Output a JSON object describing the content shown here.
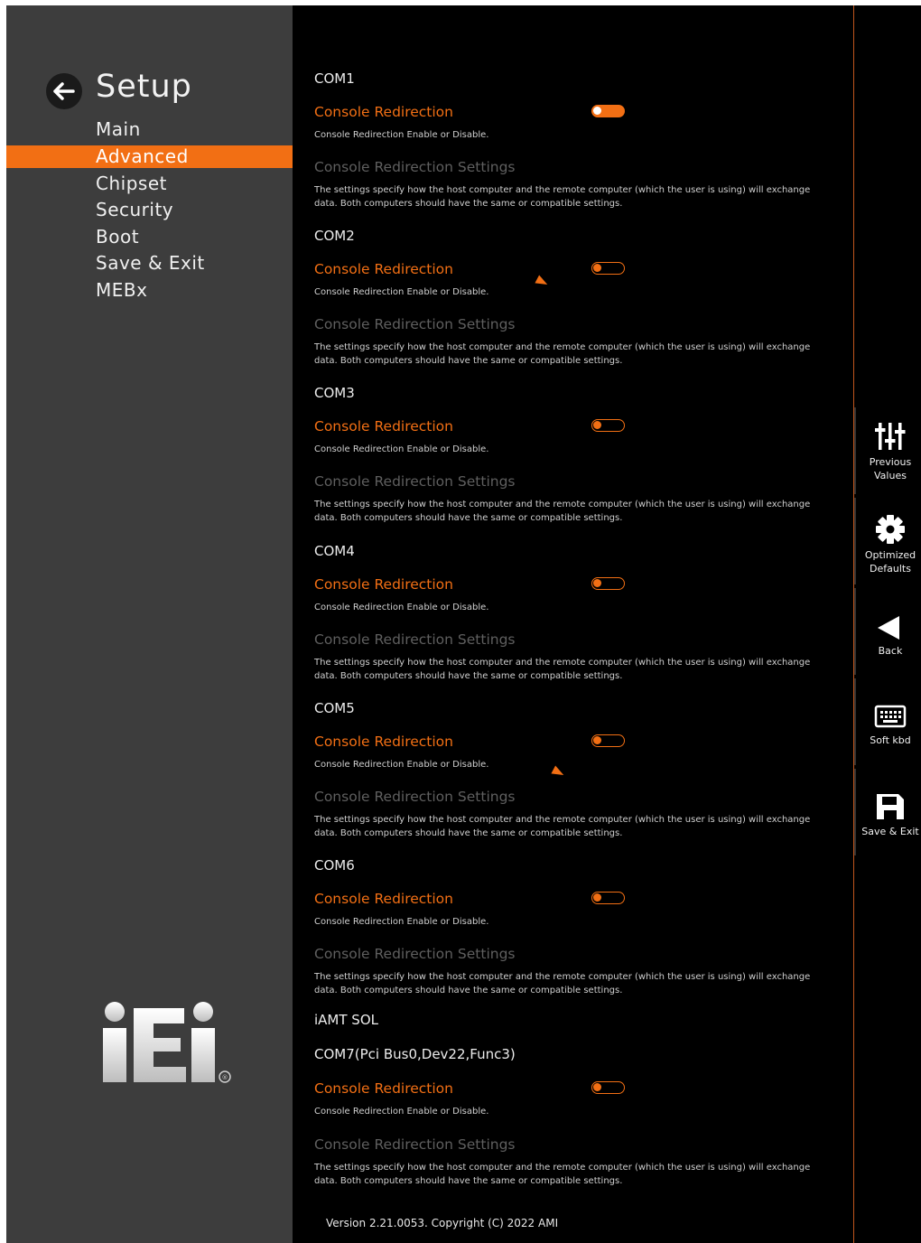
{
  "nav": {
    "title": "Setup",
    "items": [
      {
        "label": "Main",
        "active": false
      },
      {
        "label": "Advanced",
        "active": true
      },
      {
        "label": "Chipset",
        "active": false
      },
      {
        "label": "Security",
        "active": false
      },
      {
        "label": "Boot",
        "active": false
      },
      {
        "label": "Save & Exit",
        "active": false
      },
      {
        "label": "MEBx",
        "active": false
      }
    ],
    "logo_text": "iEi"
  },
  "sections": [
    {
      "title": "COM1",
      "option_label": "Console Redirection",
      "option_desc": "Console Redirection Enable or Disable.",
      "toggle_on": true,
      "sub_label": "Console Redirection Settings",
      "sub_desc": "The settings specify how the host computer and the remote computer (which the user is using) will exchange data. Both computers should have the same or compatible settings."
    },
    {
      "title": "COM2",
      "option_label": "Console Redirection",
      "option_desc": "Console Redirection Enable or Disable.",
      "toggle_on": false,
      "sub_label": "Console Redirection Settings",
      "sub_desc": "The settings specify how the host computer and the remote computer (which the user is using) will exchange data. Both computers should have the same or compatible settings."
    },
    {
      "title": "COM3",
      "option_label": "Console Redirection",
      "option_desc": "Console Redirection Enable or Disable.",
      "toggle_on": false,
      "sub_label": "Console Redirection Settings",
      "sub_desc": "The settings specify how the host computer and the remote computer (which the user is using) will exchange data. Both computers should have the same or compatible settings."
    },
    {
      "title": "COM4",
      "option_label": "Console Redirection",
      "option_desc": "Console Redirection Enable or Disable.",
      "toggle_on": false,
      "sub_label": "Console Redirection Settings",
      "sub_desc": "The settings specify how the host computer and the remote computer (which the user is using) will exchange data. Both computers should have the same or compatible settings."
    },
    {
      "title": "COM5",
      "option_label": "Console Redirection",
      "option_desc": "Console Redirection Enable or Disable.",
      "toggle_on": false,
      "sub_label": "Console Redirection Settings",
      "sub_desc": "The settings specify how the host computer and the remote computer (which the user is using) will exchange data. Both computers should have the same or compatible settings."
    },
    {
      "title": "COM6",
      "option_label": "Console Redirection",
      "option_desc": "Console Redirection Enable or Disable.",
      "toggle_on": false,
      "sub_label": "Console Redirection Settings",
      "sub_desc": "The settings specify how the host computer and the remote computer (which the user is using) will exchange data. Both computers should have the same or compatible settings."
    }
  ],
  "iamt": {
    "heading": "iAMT SOL",
    "title": "COM7(Pci Bus0,Dev22,Func3)",
    "option_label": "Console Redirection",
    "option_desc": "Console Redirection Enable or Disable.",
    "toggle_on": false,
    "sub_label": "Console Redirection Settings",
    "sub_desc": "The settings specify how the host computer and the remote computer (which the user is using) will exchange data. Both computers should have the same or compatible settings."
  },
  "version": "Version 2.21.0053. Copyright (C) 2022 AMI",
  "toolbar": [
    {
      "label": "Previous Values",
      "icon": "sliders-icon"
    },
    {
      "label": "Optimized Defaults",
      "icon": "gear-icon"
    },
    {
      "label": "Back",
      "icon": "back-triangle-icon"
    },
    {
      "label": "Soft kbd",
      "icon": "keyboard-icon"
    },
    {
      "label": "Save & Exit",
      "icon": "floppy-disk-icon"
    }
  ],
  "colors": {
    "accent": "#f26f14",
    "nav_bg": "#3d3d3d",
    "content_bg": "#000000",
    "muted": "#5f5f5f"
  }
}
